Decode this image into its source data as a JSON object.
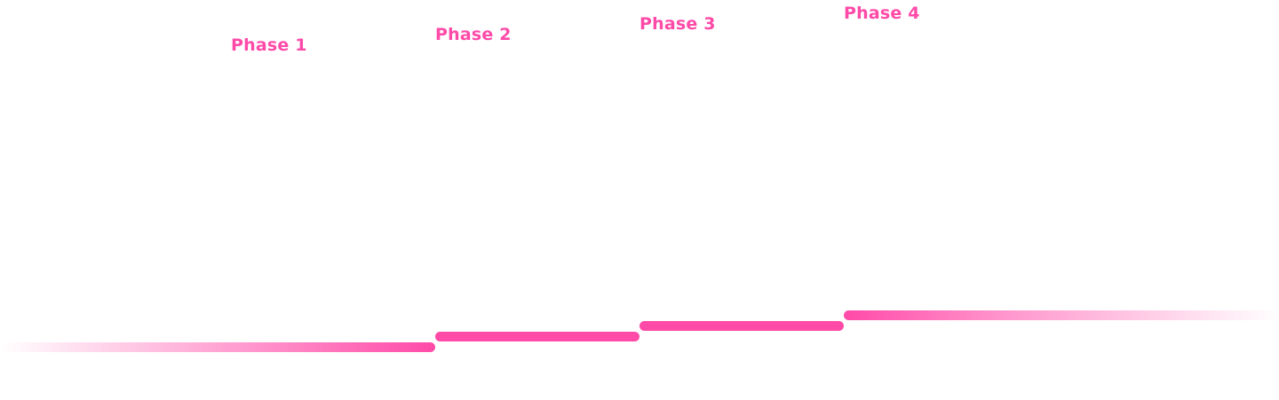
{
  "colors": {
    "accent": "#ff4aa8"
  },
  "phases": [
    {
      "label": "Phase 1"
    },
    {
      "label": "Phase 2"
    },
    {
      "label": "Phase 3"
    },
    {
      "label": "Phase 4"
    }
  ]
}
